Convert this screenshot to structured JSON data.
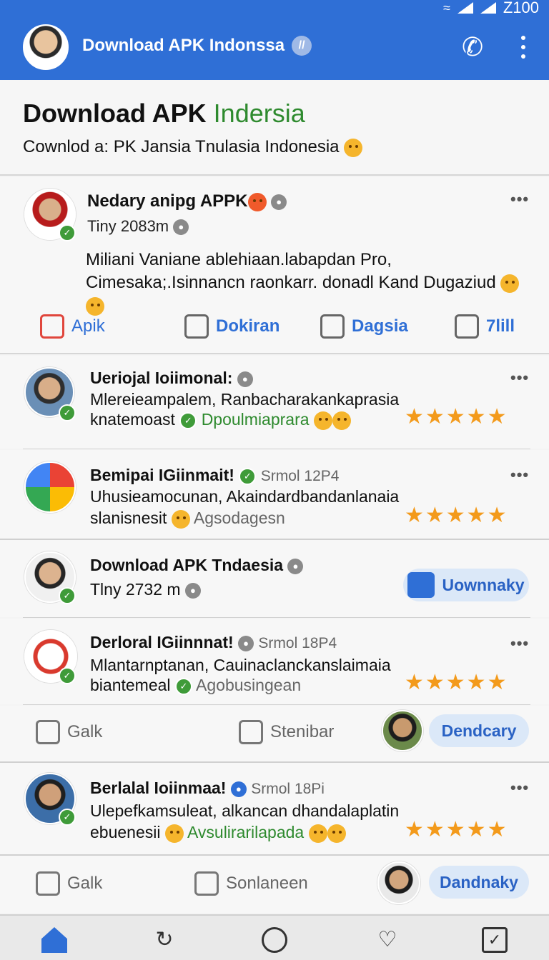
{
  "status": {
    "time": "Z100"
  },
  "app_bar": {
    "title": "Download APK Indonssa",
    "verify_glyph": "//",
    "icons": [
      "phone-icon",
      "kebab-menu-icon"
    ],
    "color": "#2f6fd6"
  },
  "header": {
    "title_main": "Download APK ",
    "title_accent": "Indersia",
    "subtitle": "Cownlod a: PK Jansia Tnulasia Indonesia"
  },
  "post": {
    "name": "Nedary anipg APPK",
    "meta": "Tiny 2083m",
    "body": "Miliani Vaniane ablehiaan.labapdan Pro, Cimesaka;.Isinnancn raonkarr. donadl Kand Dugaziud",
    "actions": [
      {
        "label": "Apik"
      },
      {
        "label": "Dokiran"
      },
      {
        "label": "Dagsia"
      },
      {
        "label": "7lill"
      }
    ]
  },
  "items": [
    {
      "title": "Ueriojal Ioiimonal:",
      "line1": "Mlereieampalem, Ranbacharakankaprasia",
      "line2_prefix": "knatemoast",
      "line2_tag": "Dpoulmiaprara",
      "stars": "★★★★★"
    },
    {
      "title": "Bemipai IGiinmait!",
      "time": "Srmol 12P4",
      "line1": "Uhusieamocunan, Akaindardbandanlanaia",
      "line2_prefix": "slanisnesit",
      "line2_tag": "Agsodagesn",
      "stars": "★★★★★"
    },
    {
      "title": "Download APK Tndaesia",
      "line1": "Tlny 2732 m",
      "button": "Uownnaky"
    },
    {
      "title": "Derloral IGiinnnat!",
      "time": "Srmol 18P4",
      "line1": "Mlantarnptanan, Cauinaclanckanslaimaia",
      "line2_prefix": "biantemeal",
      "line2_tag": "Agobusingean",
      "stars": "★★★★★"
    },
    {
      "actions": [
        "Galk",
        "Stenibar"
      ],
      "button": "Dendcary"
    },
    {
      "title": "Berlalal Ioiinmaa!",
      "time": "Srmol 18Pi",
      "line1": "Ulepefkamsuleat, alkancan dhandalaplatin",
      "line2_prefix": "ebuenesii",
      "line2_tag": "Avsulirarilapada",
      "stars": "★★★★★"
    },
    {
      "actions": [
        "Galk",
        "Sonlaneen"
      ],
      "button": "Dandnaky"
    }
  ]
}
